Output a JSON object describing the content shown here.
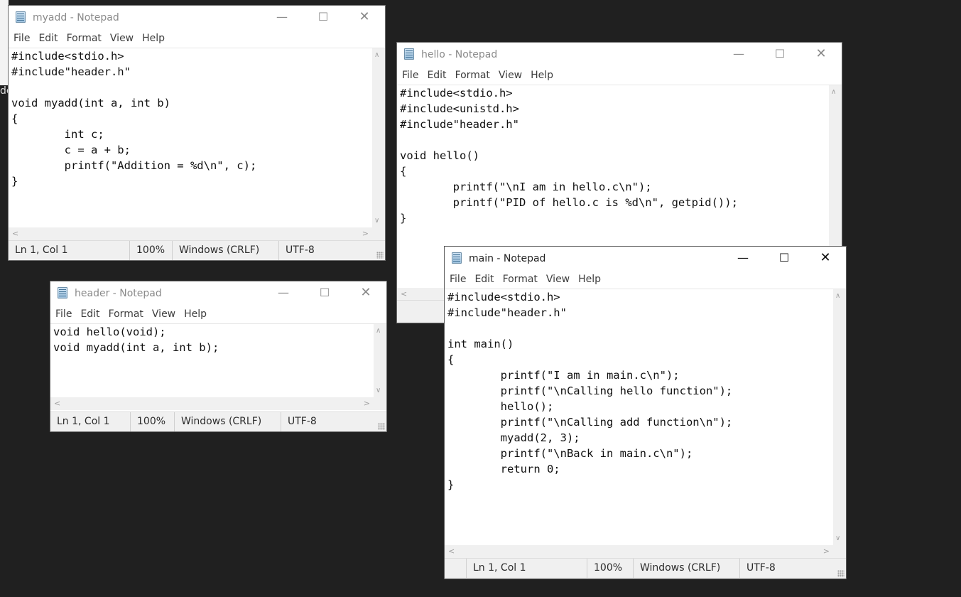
{
  "menu": [
    "File",
    "Edit",
    "Format",
    "View",
    "Help"
  ],
  "window_controls": {
    "minimize": "—",
    "maximize": "☐",
    "close": "✕"
  },
  "scroll_arrows": {
    "up": "∧",
    "down": "∨",
    "left": "<",
    "right": ">"
  },
  "background_text": "de",
  "windows": {
    "myadd": {
      "title": "myadd - Notepad",
      "lines": [
        "#include<stdio.h>",
        "#include\"header.h\"",
        "",
        "void myadd(int a, int b)",
        "{",
        "        int c;",
        "        c = a + b;",
        "        printf(\"Addition = %d\\n\", c);",
        "}"
      ],
      "status": {
        "position": "Ln 1, Col 1",
        "zoom": "100%",
        "line_ending": "Windows (CRLF)",
        "encoding": "UTF-8"
      }
    },
    "header": {
      "title": "header - Notepad",
      "lines": [
        "void hello(void);",
        "void myadd(int a, int b);"
      ],
      "status": {
        "position": "Ln 1, Col 1",
        "zoom": "100%",
        "line_ending": "Windows (CRLF)",
        "encoding": "UTF-8"
      }
    },
    "hello": {
      "title": "hello - Notepad",
      "lines": [
        "#include<stdio.h>",
        "#include<unistd.h>",
        "#include\"header.h\"",
        "",
        "void hello()",
        "{",
        "        printf(\"\\nI am in hello.c\\n\");",
        "        printf(\"PID of hello.c is %d\\n\", getpid());",
        "}"
      ]
    },
    "main": {
      "title": "main - Notepad",
      "lines": [
        "#include<stdio.h>",
        "#include\"header.h\"",
        "",
        "int main()",
        "{",
        "        printf(\"I am in main.c\\n\");",
        "        printf(\"\\nCalling hello function\");",
        "        hello();",
        "        printf(\"\\nCalling add function\\n\");",
        "        myadd(2, 3);",
        "        printf(\"\\nBack in main.c\\n\");",
        "        return 0;",
        "}"
      ],
      "status": {
        "position": "Ln 1, Col 1",
        "zoom": "100%",
        "line_ending": "Windows (CRLF)",
        "encoding": "UTF-8"
      }
    }
  }
}
